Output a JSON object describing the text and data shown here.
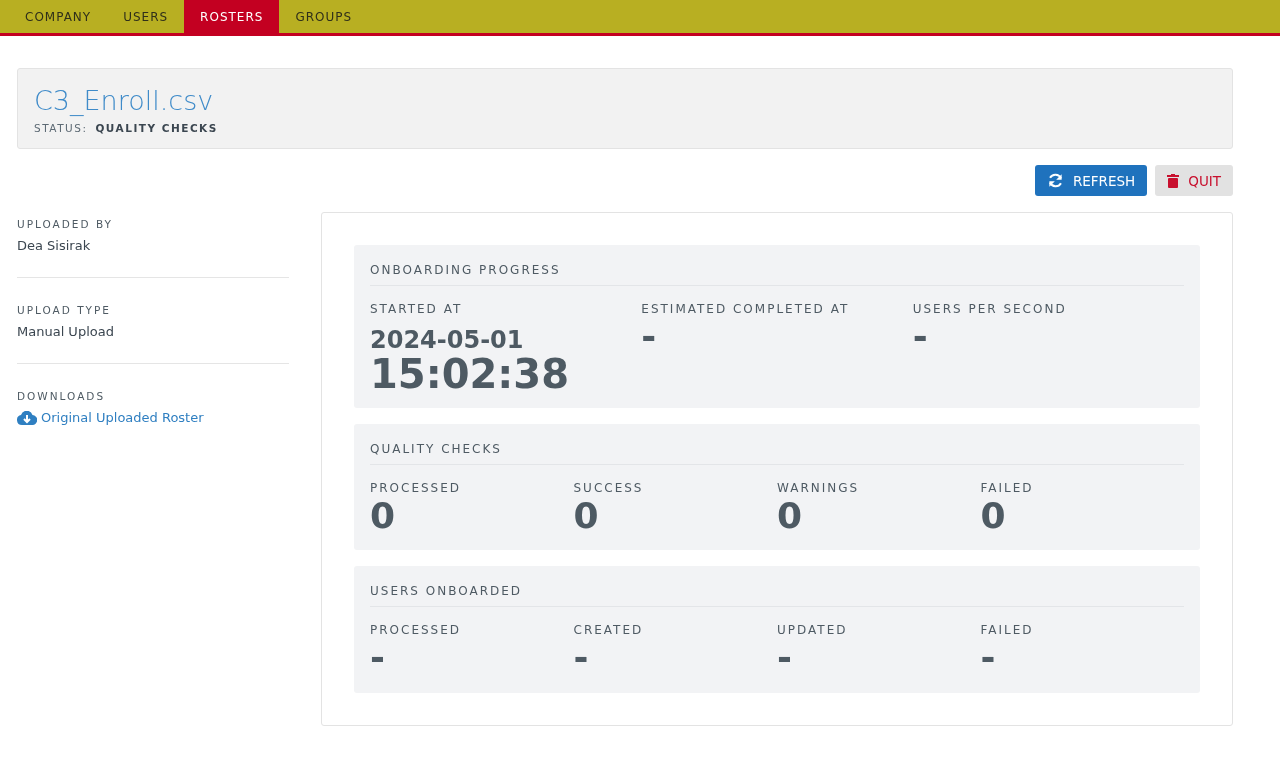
{
  "nav": {
    "tabs": [
      {
        "label": "COMPANY",
        "selected": false
      },
      {
        "label": "USERS",
        "selected": false
      },
      {
        "label": "ROSTERS",
        "selected": true
      },
      {
        "label": "GROUPS",
        "selected": false
      }
    ]
  },
  "header": {
    "title": "C3_Enroll.csv",
    "status_label": "STATUS:",
    "status": "QUALITY CHECKS"
  },
  "actions": [
    {
      "kind": "refresh",
      "label": "REFRESH"
    },
    {
      "kind": "quit",
      "label": "QUIT"
    }
  ],
  "sidebar": [
    {
      "kind": "text",
      "label": "UPLOADED BY",
      "value": "Dea Sisirak"
    },
    {
      "kind": "text",
      "label": "UPLOAD TYPE",
      "value": "Manual Upload"
    },
    {
      "kind": "link",
      "label": "DOWNLOADS",
      "value": "Original Uploaded Roster"
    }
  ],
  "sections": [
    {
      "title": "ONBOARDING PROGRESS",
      "stats": [
        {
          "label": "STARTED AT",
          "date": "2024-05-01",
          "value": "15:02:38"
        },
        {
          "label": "ESTIMATED COMPLETED AT",
          "value": "-"
        },
        {
          "label": "USERS PER SECOND",
          "value": "-"
        }
      ]
    },
    {
      "title": "QUALITY CHECKS",
      "stats": [
        {
          "label": "PROCESSED",
          "value": "0"
        },
        {
          "label": "SUCCESS",
          "value": "0"
        },
        {
          "label": "WARNINGS",
          "value": "0"
        },
        {
          "label": "FAILED",
          "value": "0"
        }
      ]
    },
    {
      "title": "USERS ONBOARDED",
      "stats": [
        {
          "label": "PROCESSED",
          "value": "-"
        },
        {
          "label": "CREATED",
          "value": "-"
        },
        {
          "label": "UPDATED",
          "value": "-"
        },
        {
          "label": "FAILED",
          "value": "-"
        }
      ]
    }
  ]
}
